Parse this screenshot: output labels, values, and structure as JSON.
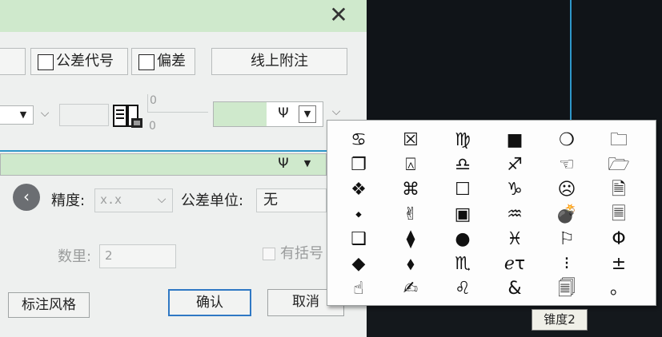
{
  "close_glyph": "✕",
  "row1": {
    "tolerance_code_label": "公差代号",
    "deviation_label": "偏差",
    "above_line_note_label": "线上附注"
  },
  "row2": {
    "dropdown_arrow": "▼",
    "value_top": "0",
    "value_bottom": "0",
    "symbol_value": "Ψ"
  },
  "row3": {
    "symbol_value": "Ψ"
  },
  "settings": {
    "precision_label": "精度:",
    "precision_value": "x.x",
    "tolerance_unit_label": "公差单位:",
    "tolerance_unit_value": "无",
    "quantity_label": "数里:",
    "quantity_value": "2",
    "bracket_label": "有括号"
  },
  "buttons": {
    "style": "标注风格",
    "confirm": "确认",
    "cancel": "取消"
  },
  "symbol_panel": {
    "rows": [
      [
        "♋",
        "☒",
        "♍",
        "■",
        "❍",
        "🗀"
      ],
      [
        "❐",
        "⍓",
        "♎",
        "♐",
        "☜",
        "🗁"
      ],
      [
        "❖",
        "⌘",
        "☐",
        "♑",
        "☹",
        "🗎"
      ],
      [
        "⬩",
        "✌",
        "▣",
        "♒",
        "💣",
        "🗏"
      ],
      [
        "❑",
        "⧫",
        "●",
        "♓",
        "⚐",
        "Φ"
      ],
      [
        "◆",
        "⬧",
        "♏",
        "ℯτ",
        "⁝",
        "±"
      ],
      [
        "☝",
        "✍",
        "♌",
        "&",
        "🗐",
        "。"
      ]
    ]
  },
  "tooltip": "锥度2",
  "colors": {
    "title_bar": "#cfe9cc",
    "symbol_field": "#cfe9cc",
    "accent_line": "#2e97c9",
    "confirm_border": "#2f78c4"
  }
}
